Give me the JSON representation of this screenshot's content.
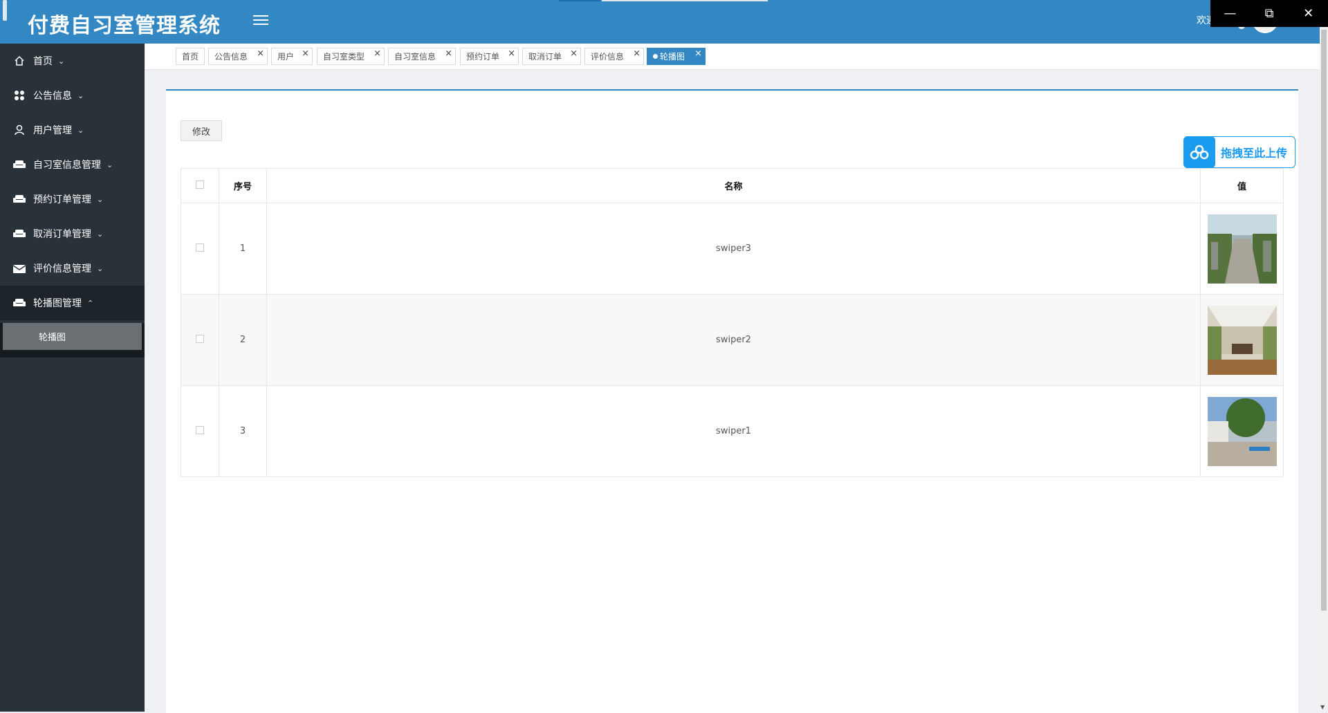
{
  "header": {
    "title": "付费自习室管理系统",
    "welcome": "欢迎"
  },
  "sidebar": {
    "items": [
      {
        "label": "首页",
        "icon": "home-icon"
      },
      {
        "label": "公告信息",
        "icon": "grid-icon"
      },
      {
        "label": "用户管理",
        "icon": "user-icon"
      },
      {
        "label": "自习室信息管理",
        "icon": "sofa-icon"
      },
      {
        "label": "预约订单管理",
        "icon": "sofa-icon"
      },
      {
        "label": "取消订单管理",
        "icon": "sofa-icon"
      },
      {
        "label": "评价信息管理",
        "icon": "mail-icon"
      },
      {
        "label": "轮播图管理",
        "icon": "sofa-icon"
      }
    ],
    "sub_active": "轮播图"
  },
  "tabs": [
    {
      "label": "首页"
    },
    {
      "label": "公告信息"
    },
    {
      "label": "用户"
    },
    {
      "label": "自习室类型"
    },
    {
      "label": "自习室信息"
    },
    {
      "label": "预约订单"
    },
    {
      "label": "取消订单"
    },
    {
      "label": "评价信息"
    },
    {
      "label": "轮播图"
    }
  ],
  "toolbar": {
    "edit_label": "修改"
  },
  "upload": {
    "label": "拖拽至此上传"
  },
  "table": {
    "headers": {
      "index": "序号",
      "name": "名称",
      "value": "值"
    },
    "rows": [
      {
        "index": "1",
        "name": "swiper3",
        "image": "street-photo"
      },
      {
        "index": "2",
        "name": "swiper2",
        "image": "sunroom-photo"
      },
      {
        "index": "3",
        "name": "swiper1",
        "image": "courtyard-photo"
      }
    ]
  },
  "colors": {
    "header": "#3388c3",
    "sidebar": "#293238",
    "accent_upload": "#1a9bf0"
  }
}
